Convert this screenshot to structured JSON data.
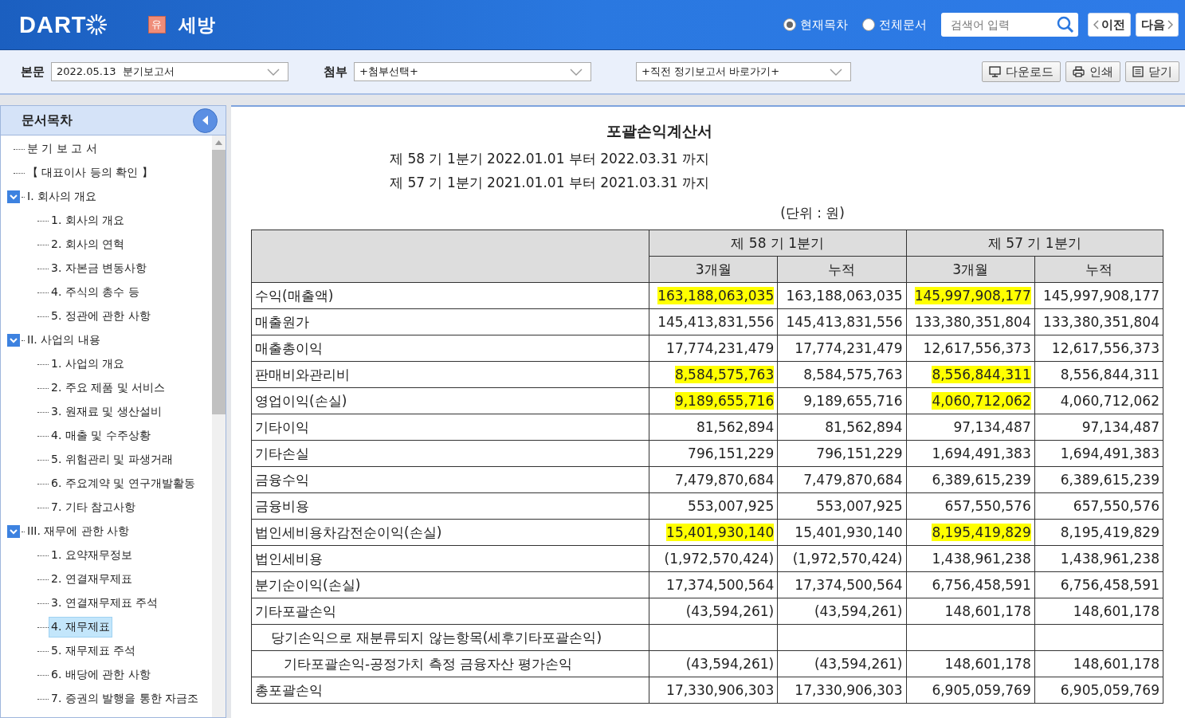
{
  "header": {
    "logo": "DART",
    "company_badge": "유",
    "company": "세방",
    "scope_options": [
      {
        "label": "현재목차",
        "selected": true
      },
      {
        "label": "전체문서",
        "selected": false
      }
    ],
    "search": {
      "placeholder": "검색어 입력"
    },
    "prev_button": "이전",
    "next_button": "다음"
  },
  "toolbar": {
    "main_label": "본문",
    "main_select": "2022.05.13  분기보고서",
    "attach_label": "첨부",
    "attach_select": "+첨부선택+",
    "shortcut_select": "+직전 정기보고서 바로가기+",
    "buttons": [
      {
        "kind": "download",
        "label": "다운로드"
      },
      {
        "kind": "print",
        "label": "인쇄"
      },
      {
        "kind": "close",
        "label": "닫기"
      }
    ]
  },
  "sidebar": {
    "title": "문서목차",
    "items": [
      {
        "label": "분 기 보 고 서",
        "selected": false
      },
      {
        "label": "【 대표이사 등의 확인 】",
        "selected": false
      },
      {
        "label": "I. 회사의 개요",
        "selected": false,
        "expanded": true,
        "children": [
          {
            "label": "1. 회사의 개요",
            "selected": false
          },
          {
            "label": "2. 회사의 연혁",
            "selected": false
          },
          {
            "label": "3. 자본금 변동사항",
            "selected": false
          },
          {
            "label": "4. 주식의 총수 등",
            "selected": false
          },
          {
            "label": "5. 정관에 관한 사항",
            "selected": false
          }
        ]
      },
      {
        "label": "II. 사업의 내용",
        "selected": false,
        "expanded": true,
        "children": [
          {
            "label": "1. 사업의 개요",
            "selected": false
          },
          {
            "label": "2. 주요 제품 및 서비스",
            "selected": false
          },
          {
            "label": "3. 원재료 및 생산설비",
            "selected": false
          },
          {
            "label": "4. 매출 및 수주상황",
            "selected": false
          },
          {
            "label": "5. 위험관리 및 파생거래",
            "selected": false
          },
          {
            "label": "6. 주요계약 및 연구개발활동",
            "selected": false
          },
          {
            "label": "7. 기타 참고사항",
            "selected": false
          }
        ]
      },
      {
        "label": "III. 재무에 관한 사항",
        "selected": false,
        "expanded": true,
        "children": [
          {
            "label": "1. 요약재무정보",
            "selected": false
          },
          {
            "label": "2. 연결재무제표",
            "selected": false
          },
          {
            "label": "3. 연결재무제표 주석",
            "selected": false
          },
          {
            "label": "4. 재무제표",
            "selected": true
          },
          {
            "label": "5. 재무제표 주석",
            "selected": false
          },
          {
            "label": "6. 배당에 관한 사항",
            "selected": false
          },
          {
            "label": "7. 증권의 발행을 통한 자금조",
            "selected": false
          }
        ]
      }
    ]
  },
  "document": {
    "title": "포괄손익계산서",
    "periods": [
      "제 58 기 1분기 2022.01.01 부터 2022.03.31 까지",
      "제 57 기 1분기 2021.01.01 부터 2021.03.31 까지"
    ],
    "unit": "(단위 : 원)",
    "table": {
      "group_headers": [
        "제 58 기 1분기",
        "제 57 기 1분기"
      ],
      "sub_headers": [
        "3개월",
        "누적",
        "3개월",
        "누적"
      ],
      "rows": [
        {
          "kind": "item",
          "label": "수익(매출액)",
          "cells": [
            {
              "value": "163,188,063,035",
              "highlighted": true
            },
            {
              "value": "163,188,063,035",
              "highlighted": false
            },
            {
              "value": "145,997,908,177",
              "highlighted": true
            },
            {
              "value": "145,997,908,177",
              "highlighted": false
            }
          ]
        },
        {
          "kind": "item",
          "label": "매출원가",
          "cells": [
            {
              "value": "145,413,831,556",
              "highlighted": false
            },
            {
              "value": "145,413,831,556",
              "highlighted": false
            },
            {
              "value": "133,380,351,804",
              "highlighted": false
            },
            {
              "value": "133,380,351,804",
              "highlighted": false
            }
          ]
        },
        {
          "kind": "item",
          "label": "매출총이익",
          "cells": [
            {
              "value": "17,774,231,479",
              "highlighted": false
            },
            {
              "value": "17,774,231,479",
              "highlighted": false
            },
            {
              "value": "12,617,556,373",
              "highlighted": false
            },
            {
              "value": "12,617,556,373",
              "highlighted": false
            }
          ]
        },
        {
          "kind": "item",
          "label": "판매비와관리비",
          "cells": [
            {
              "value": "8,584,575,763",
              "highlighted": true
            },
            {
              "value": "8,584,575,763",
              "highlighted": false
            },
            {
              "value": "8,556,844,311",
              "highlighted": true
            },
            {
              "value": "8,556,844,311",
              "highlighted": false
            }
          ]
        },
        {
          "kind": "item",
          "label": "영업이익(손실)",
          "cells": [
            {
              "value": "9,189,655,716",
              "highlighted": true
            },
            {
              "value": "9,189,655,716",
              "highlighted": false
            },
            {
              "value": "4,060,712,062",
              "highlighted": true
            },
            {
              "value": "4,060,712,062",
              "highlighted": false
            }
          ]
        },
        {
          "kind": "item",
          "label": "기타이익",
          "cells": [
            {
              "value": "81,562,894",
              "highlighted": false
            },
            {
              "value": "81,562,894",
              "highlighted": false
            },
            {
              "value": "97,134,487",
              "highlighted": false
            },
            {
              "value": "97,134,487",
              "highlighted": false
            }
          ]
        },
        {
          "kind": "item",
          "label": "기타손실",
          "cells": [
            {
              "value": "796,151,229",
              "highlighted": false
            },
            {
              "value": "796,151,229",
              "highlighted": false
            },
            {
              "value": "1,694,491,383",
              "highlighted": false
            },
            {
              "value": "1,694,491,383",
              "highlighted": false
            }
          ]
        },
        {
          "kind": "item",
          "label": "금융수익",
          "cells": [
            {
              "value": "7,479,870,684",
              "highlighted": false
            },
            {
              "value": "7,479,870,684",
              "highlighted": false
            },
            {
              "value": "6,389,615,239",
              "highlighted": false
            },
            {
              "value": "6,389,615,239",
              "highlighted": false
            }
          ]
        },
        {
          "kind": "item",
          "label": "금융비용",
          "cells": [
            {
              "value": "553,007,925",
              "highlighted": false
            },
            {
              "value": "553,007,925",
              "highlighted": false
            },
            {
              "value": "657,550,576",
              "highlighted": false
            },
            {
              "value": "657,550,576",
              "highlighted": false
            }
          ]
        },
        {
          "kind": "item",
          "label": "법인세비용차감전순이익(손실)",
          "cells": [
            {
              "value": "15,401,930,140",
              "highlighted": true
            },
            {
              "value": "15,401,930,140",
              "highlighted": false
            },
            {
              "value": "8,195,419,829",
              "highlighted": true
            },
            {
              "value": "8,195,419,829",
              "highlighted": false
            }
          ]
        },
        {
          "kind": "item",
          "label": "법인세비용",
          "cells": [
            {
              "value": "(1,972,570,424)",
              "highlighted": false
            },
            {
              "value": "(1,972,570,424)",
              "highlighted": false
            },
            {
              "value": "1,438,961,238",
              "highlighted": false
            },
            {
              "value": "1,438,961,238",
              "highlighted": false
            }
          ]
        },
        {
          "kind": "item",
          "label": "분기순이익(손실)",
          "cells": [
            {
              "value": "17,374,500,564",
              "highlighted": false
            },
            {
              "value": "17,374,500,564",
              "highlighted": false
            },
            {
              "value": "6,756,458,591",
              "highlighted": false
            },
            {
              "value": "6,756,458,591",
              "highlighted": false
            }
          ]
        },
        {
          "kind": "item",
          "label": "기타포괄손익",
          "cells": [
            {
              "value": "(43,594,261)",
              "highlighted": false
            },
            {
              "value": "(43,594,261)",
              "highlighted": false
            },
            {
              "value": "148,601,178",
              "highlighted": false
            },
            {
              "value": "148,601,178",
              "highlighted": false
            }
          ]
        },
        {
          "kind": "group",
          "label": "당기손익으로 재분류되지 않는항목(세후기타포괄손익)",
          "cells": []
        },
        {
          "kind": "sub",
          "label": "기타포괄손익-공정가치 측정 금융자산 평가손익",
          "cells": [
            {
              "value": "(43,594,261)",
              "highlighted": false
            },
            {
              "value": "(43,594,261)",
              "highlighted": false
            },
            {
              "value": "148,601,178",
              "highlighted": false
            },
            {
              "value": "148,601,178",
              "highlighted": false
            }
          ]
        },
        {
          "kind": "item",
          "label": "총포괄손익",
          "cells": [
            {
              "value": "17,330,906,303",
              "highlighted": false
            },
            {
              "value": "17,330,906,303",
              "highlighted": false
            },
            {
              "value": "6,905,059,769",
              "highlighted": false
            },
            {
              "value": "6,905,059,769",
              "highlighted": false
            }
          ]
        }
      ]
    }
  }
}
